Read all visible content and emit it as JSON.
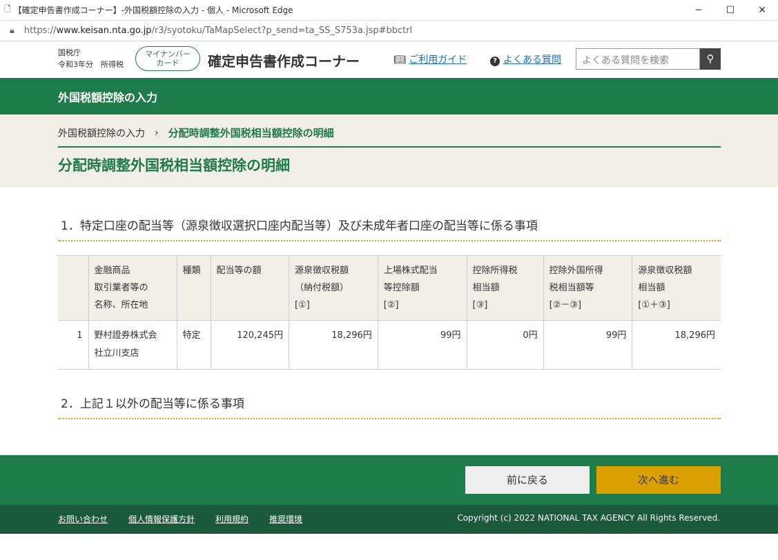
{
  "window": {
    "title": "【確定申告書作成コーナー】-外国税額控除の入力 - 個人 - Microsoft Edge",
    "minimize": "─",
    "maximize": "☐",
    "close": "✕"
  },
  "address": {
    "prefix": "https://",
    "host": "www.keisan.nta.go.jp",
    "path": "/r3/syotoku/TaMapSelect?p_send=ta_SS_S753a.jsp#bbctrl"
  },
  "header": {
    "agency": "国税庁",
    "year": "令和3年分　所得税",
    "mycard_line1": "マイナンバー",
    "mycard_line2": "カード",
    "site_title": "確定申告書作成コーナー",
    "guide": "ご利用ガイド",
    "faq": "よくある質問",
    "search_placeholder": "よくある質問を検索"
  },
  "greenbar": {
    "title": "外国税額控除の入力"
  },
  "breadcrumb": {
    "items": [
      "外国税額控除の入力",
      "分配時調整外国税相当額控除の明細"
    ],
    "sep": "›"
  },
  "page_title": "分配時調整外国税相当額控除の明細",
  "section1": "1．特定口座の配当等（源泉徴収選択口座内配当等）及び未成年者口座の配当等に係る事項",
  "section2": "2．上記１以外の配当等に係る事項",
  "table": {
    "headers": [
      [
        "",
        "",
        " "
      ],
      [
        "金融商品",
        "取引業者等の",
        "名称、所在地"
      ],
      [
        "種類",
        "",
        ""
      ],
      [
        "配当等の額",
        "",
        ""
      ],
      [
        "源泉徴収税額",
        "（納付税額）",
        "[①]"
      ],
      [
        "上場株式配当",
        "等控除額",
        "[②]"
      ],
      [
        "控除所得税",
        "相当額",
        "[③]"
      ],
      [
        "控除外国所得",
        "税相当額等",
        "[②－③]"
      ],
      [
        "源泉徴収税額",
        "相当額",
        "[①＋③]"
      ]
    ],
    "rows": [
      {
        "no": "1",
        "name1": "野村證券株式会",
        "name2": "社立川支店",
        "type": "特定",
        "dividend": "120,245円",
        "withheld": "18,296円",
        "listed_deduction": "99円",
        "deduct_income_tax": "0円",
        "foreign_tax": "99円",
        "withheld_equiv": "18,296円"
      }
    ]
  },
  "buttons": {
    "back": "前に戻る",
    "next": "次へ進む"
  },
  "footer": {
    "links": [
      "お問い合わせ",
      "個人情報保護方針",
      "利用規約",
      "推奨環境"
    ],
    "copyright": "Copyright (c) 2022 NATIONAL TAX AGENCY All Rights Reserved."
  }
}
